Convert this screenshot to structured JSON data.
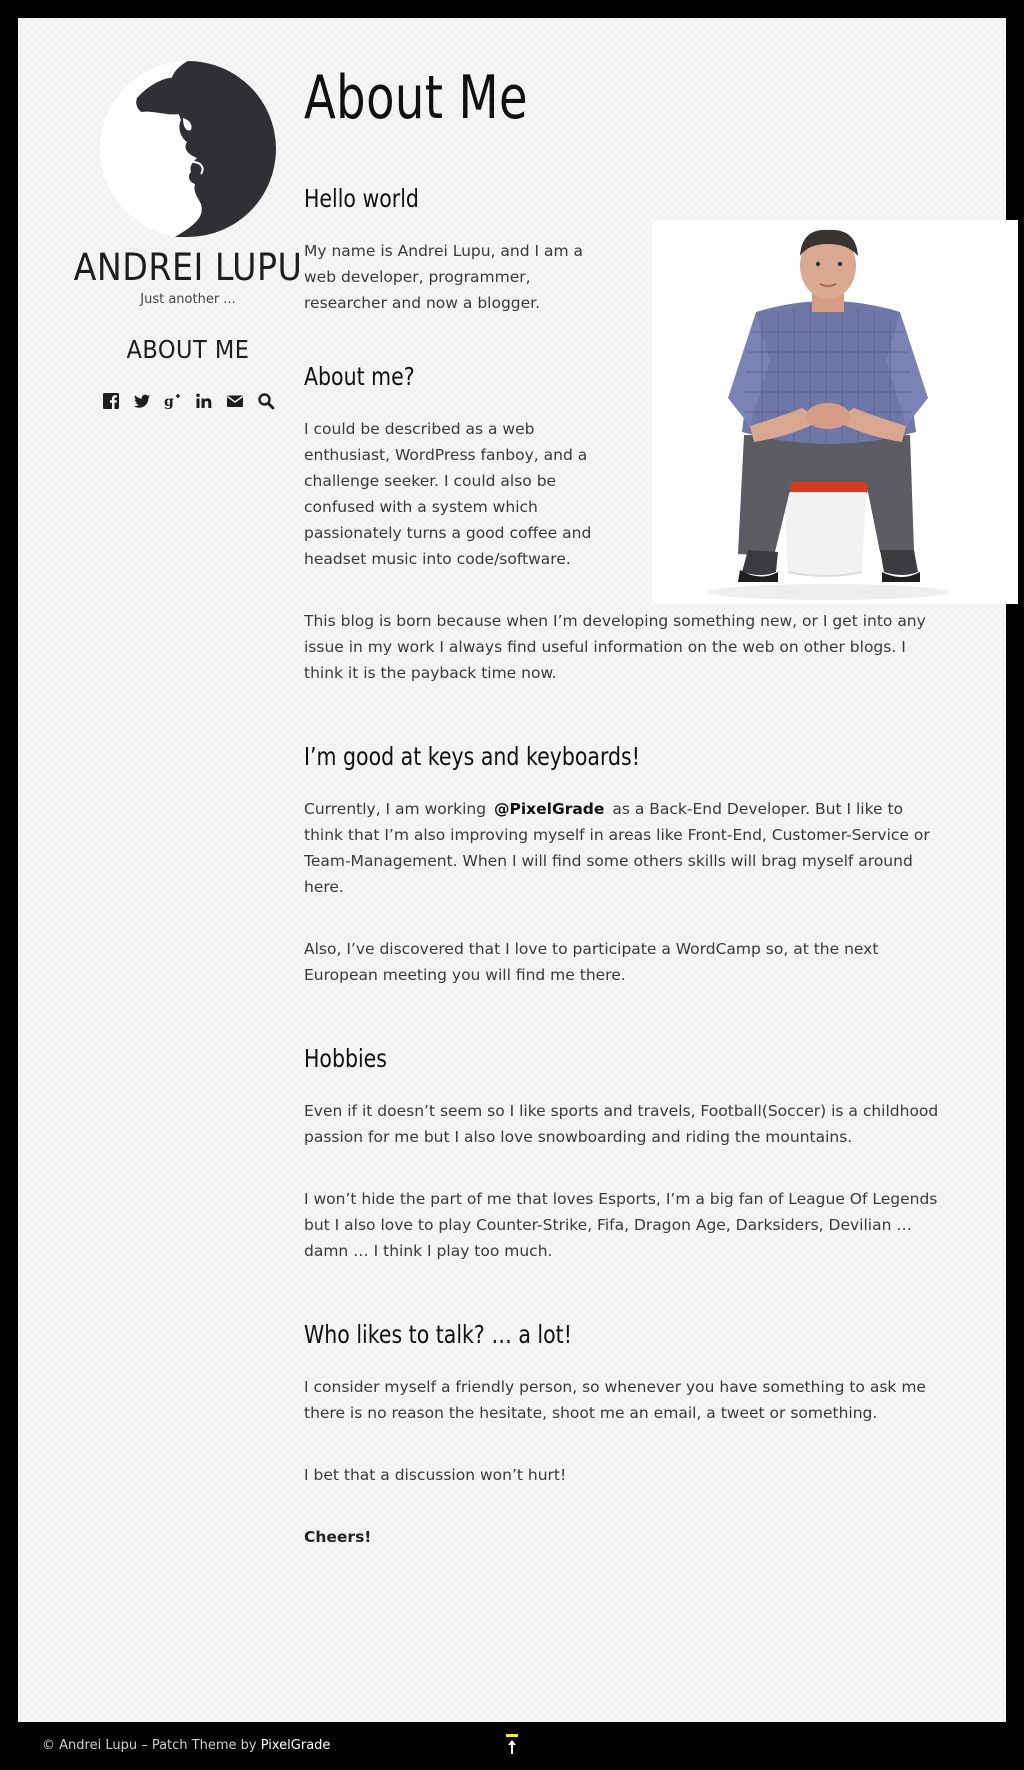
{
  "site": {
    "title": "ANDREI LUPU",
    "tagline": "Just another ...",
    "current_nav": "ABOUT ME",
    "social_icons": [
      "facebook-icon",
      "twitter-icon",
      "google-plus-icon",
      "linkedin-icon",
      "email-icon",
      "search-icon"
    ]
  },
  "colors": {
    "accent": "#ffeb00",
    "background": "#f6f6f6",
    "text": "#3a3a3a"
  },
  "page": {
    "title": "About Me",
    "sections": {
      "hello": {
        "heading": "Hello world",
        "p1": "My name is Andrei Lupu, and I am a web developer, programmer, researcher and now a blogger."
      },
      "about": {
        "heading": "About me?",
        "p1": "I could be described as a web enthusiast, WordPress fanboy, and a challenge seeker. I could also be confused with a system which passionately turns a good coffee and headset music into code/software.",
        "p2": "This blog is born because when I’m developing something new, or I get into any issue in my work I always find useful information on the web on other blogs. I think it is the payback time now."
      },
      "keys": {
        "heading": "I’m good at keys and keyboards!",
        "p1_before": "Currently, I am working ",
        "p1_link": "@PixelGrade",
        "p1_after": " as a Back-End Developer. But I like to think that I’m also improving myself in areas like Front-End, Customer-Service or Team-Management. When I will find some others skills will brag myself around here.",
        "p2": "Also, I’ve discovered that I love to participate a WordCamp so, at the next European meeting you will find me there."
      },
      "hobbies": {
        "heading": "Hobbies",
        "p1": "Even if it doesn’t seem so I like sports and travels, Football(Soccer) is a childhood passion for me but I also love snowboarding and riding the mountains.",
        "p2": "I won’t hide the part of me that loves Esports, I’m a big fan of League Of Legends but I also love to play Counter-Strike, Fifa, Dragon Age, Darksiders, Devilian … damn … I think I play too much."
      },
      "talk": {
        "heading": "Who likes to talk? … a lot!",
        "p1": "I consider myself a friendly person, so whenever you have something to ask me there is no reason the hesitate, shoot me an email, a tweet or something.",
        "p2": "I bet that a discussion won’t hurt!",
        "p3": "Cheers!"
      }
    }
  },
  "footer": {
    "copyright": "© Andrei Lupu – Patch Theme by ",
    "theme_link": "PixelGrade",
    "top_icon": "arrow-up-icon"
  }
}
